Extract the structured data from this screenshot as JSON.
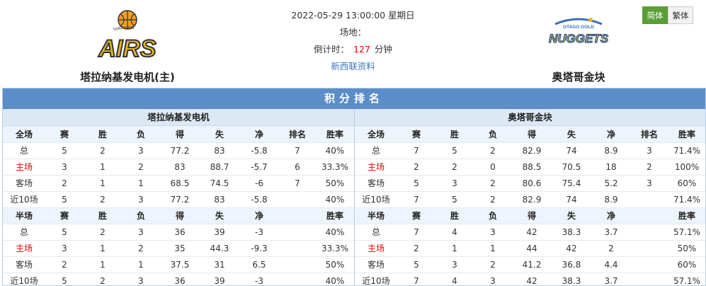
{
  "match": {
    "datetime": "2022-05-29 13:00:00 星期日",
    "venue_label": "场地：",
    "countdown_label": "倒计时：",
    "countdown_value": "127",
    "countdown_unit": "分钟",
    "source": "新西联资料"
  },
  "home_team": {
    "name": "塔拉纳基发电机(主)",
    "logo_text": "AIRS",
    "logo_arc": "TARANAKI"
  },
  "away_team": {
    "name": "奥塔哥金块",
    "logo_text": "NUGGETS",
    "logo_arc": "OTAGO GOLD"
  },
  "lang_buttons": [
    "简体",
    "繁体"
  ],
  "panel_title": "积分排名",
  "colors": {
    "accent_blue": "#5b8dc9",
    "highlight_red": "#e00000",
    "lang_active": "#5a9e36"
  },
  "halves": [
    {
      "team": "塔拉纳基发电机",
      "full_header": [
        "全场",
        "赛",
        "胜",
        "负",
        "得",
        "失",
        "净",
        "排名",
        "胜率"
      ],
      "full_rows": [
        [
          "总",
          "5",
          "2",
          "3",
          "77.2",
          "83",
          "-5.8",
          "7",
          "40%"
        ],
        [
          "主场",
          "3",
          "1",
          "2",
          "83",
          "88.7",
          "-5.7",
          "6",
          "33.3%"
        ],
        [
          "客场",
          "2",
          "1",
          "1",
          "68.5",
          "74.5",
          "-6",
          "7",
          "50%"
        ],
        [
          "近10场",
          "5",
          "2",
          "3",
          "77.2",
          "83",
          "-5.8",
          "",
          "40%"
        ]
      ],
      "half_header": [
        "半场",
        "赛",
        "胜",
        "负",
        "得",
        "失",
        "净",
        "",
        "胜率"
      ],
      "half_rows": [
        [
          "总",
          "5",
          "2",
          "3",
          "36",
          "39",
          "-3",
          "",
          "40%"
        ],
        [
          "主场",
          "3",
          "1",
          "2",
          "35",
          "44.3",
          "-9.3",
          "",
          "33.3%"
        ],
        [
          "客场",
          "2",
          "1",
          "1",
          "37.5",
          "31",
          "6.5",
          "",
          "50%"
        ],
        [
          "近10场",
          "5",
          "2",
          "3",
          "36",
          "39",
          "-3",
          "",
          "40%"
        ]
      ]
    },
    {
      "team": "奥塔哥金块",
      "full_header": [
        "全场",
        "赛",
        "胜",
        "负",
        "得",
        "失",
        "净",
        "排名",
        "胜率"
      ],
      "full_rows": [
        [
          "总",
          "7",
          "5",
          "2",
          "82.9",
          "74",
          "8.9",
          "3",
          "71.4%"
        ],
        [
          "主场",
          "2",
          "2",
          "0",
          "88.5",
          "70.5",
          "18",
          "2",
          "100%"
        ],
        [
          "客场",
          "5",
          "3",
          "2",
          "80.6",
          "75.4",
          "5.2",
          "3",
          "60%"
        ],
        [
          "近10场",
          "7",
          "5",
          "2",
          "82.9",
          "74",
          "8.9",
          "",
          "71.4%"
        ]
      ],
      "half_header": [
        "半场",
        "赛",
        "胜",
        "负",
        "得",
        "失",
        "净",
        "",
        "胜率"
      ],
      "half_rows": [
        [
          "总",
          "7",
          "4",
          "3",
          "42",
          "38.3",
          "3.7",
          "",
          "57.1%"
        ],
        [
          "主场",
          "2",
          "1",
          "1",
          "44",
          "42",
          "2",
          "",
          "50%"
        ],
        [
          "客场",
          "5",
          "3",
          "2",
          "41.2",
          "36.8",
          "4.4",
          "",
          "60%"
        ],
        [
          "近10场",
          "7",
          "4",
          "3",
          "42",
          "38.3",
          "3.7",
          "",
          "57.1%"
        ]
      ]
    }
  ]
}
